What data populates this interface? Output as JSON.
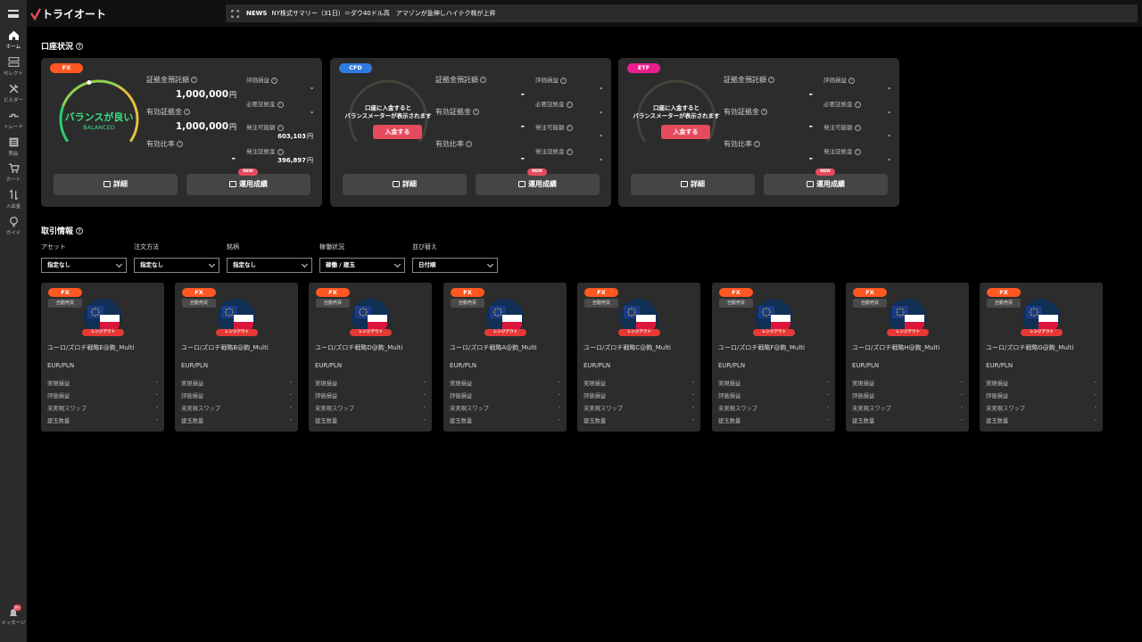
{
  "app": {
    "logo": "トライオート"
  },
  "news": {
    "label": "NEWS",
    "headline": "NY株式サマリー（31日）＝ダウ40ドル高　アマゾンが急伸しハイテク株が上昇"
  },
  "sidebar": {
    "items": [
      {
        "label": "ホーム",
        "icon": "home-icon"
      },
      {
        "label": "セレクト",
        "icon": "select-icon"
      },
      {
        "label": "ビルダー",
        "icon": "builder-icon"
      },
      {
        "label": "トレード",
        "icon": "trade-icon"
      },
      {
        "label": "照会",
        "icon": "inquiry-icon"
      },
      {
        "label": "カート",
        "icon": "cart-icon"
      },
      {
        "label": "入出金",
        "icon": "transfer-icon"
      },
      {
        "label": "ガイド",
        "icon": "guide-icon"
      }
    ],
    "message": {
      "label": "メッセージ",
      "count": "9+"
    }
  },
  "account_section": {
    "title": "口座状況"
  },
  "accounts": [
    {
      "badge": "FX",
      "badge_color": "#ff5722",
      "gauge": {
        "status": "バランスが良い",
        "status_en": "BALANCED",
        "color": "#3ddc84"
      },
      "left": [
        {
          "label": "証拠金預託額",
          "value": "1,000,000",
          "unit": "円"
        },
        {
          "label": "有効証拠金",
          "value": "1,000,000",
          "unit": "円"
        },
        {
          "label": "有効比率",
          "value": "-",
          "unit": ""
        }
      ],
      "right": [
        {
          "label": "評価損益",
          "value": "-"
        },
        {
          "label": "必要証拠金",
          "value": "-"
        },
        {
          "label": "発注可能額",
          "value": "603,103",
          "unit": "円"
        },
        {
          "label": "発注証拠金",
          "value": "396,897",
          "unit": "円"
        }
      ],
      "buttons": {
        "detail": "詳細",
        "performance": "運用成績",
        "new": "NEW"
      }
    },
    {
      "badge": "CFD",
      "badge_color": "#2e7be0",
      "gauge": {
        "message_line1": "口座に入金すると",
        "message_line2": "バランスメーターが表示されます",
        "deposit": "入金する"
      },
      "left": [
        {
          "label": "証拠金預託額",
          "value": "-",
          "unit": ""
        },
        {
          "label": "有効証拠金",
          "value": "-",
          "unit": ""
        },
        {
          "label": "有効比率",
          "value": "-",
          "unit": ""
        }
      ],
      "right": [
        {
          "label": "評価損益",
          "value": "-"
        },
        {
          "label": "必要証拠金",
          "value": "-"
        },
        {
          "label": "発注可能額",
          "value": "-"
        },
        {
          "label": "発注証拠金",
          "value": "-"
        }
      ],
      "buttons": {
        "detail": "詳細",
        "performance": "運用成績",
        "new": "NEW"
      }
    },
    {
      "badge": "ETF",
      "badge_color": "#e91e8c",
      "gauge": {
        "message_line1": "口座に入金すると",
        "message_line2": "バランスメーターが表示されます",
        "deposit": "入金する"
      },
      "left": [
        {
          "label": "証拠金預託額",
          "value": "-",
          "unit": ""
        },
        {
          "label": "有効証拠金",
          "value": "-",
          "unit": ""
        },
        {
          "label": "有効比率",
          "value": "-",
          "unit": ""
        }
      ],
      "right": [
        {
          "label": "評価損益",
          "value": "-"
        },
        {
          "label": "必要証拠金",
          "value": "-"
        },
        {
          "label": "発注可能額",
          "value": "-"
        },
        {
          "label": "発注証拠金",
          "value": "-"
        }
      ],
      "buttons": {
        "detail": "詳細",
        "performance": "運用成績",
        "new": "NEW"
      }
    }
  ],
  "trade_section": {
    "title": "取引情報"
  },
  "filters": [
    {
      "label": "アセット",
      "value": "指定なし"
    },
    {
      "label": "注文方法",
      "value": "指定なし"
    },
    {
      "label": "銘柄",
      "value": "指定なし"
    },
    {
      "label": "稼働状況",
      "value": "稼働 / 建玉"
    },
    {
      "label": "並び替え",
      "value": "日付順"
    }
  ],
  "strategy_card_labels": {
    "asset": "FX",
    "mode": "自動売買",
    "range": "レンジアウト",
    "rows": [
      "実現損益",
      "評価損益",
      "未実現スワップ",
      "建玉数量"
    ]
  },
  "strategies": [
    {
      "name": "ユーロ/ズロチ戦略E@鉤_Multi",
      "pair": "EUR/PLN",
      "values": [
        "-",
        "-",
        "-",
        "-"
      ]
    },
    {
      "name": "ユーロ/ズロチ戦略B@鉤_Multi",
      "pair": "EUR/PLN",
      "values": [
        "-",
        "-",
        "-",
        "-"
      ]
    },
    {
      "name": "ユーロ/ズロチ戦略D@鉤_Multi",
      "pair": "EUR/PLN",
      "values": [
        "-",
        "-",
        "-",
        "-"
      ]
    },
    {
      "name": "ユーロ/ズロチ戦略A@鉤_Multi",
      "pair": "EUR/PLN",
      "values": [
        "-",
        "-",
        "-",
        "-"
      ]
    },
    {
      "name": "ユーロ/ズロチ戦略C@鉤_Multi",
      "pair": "EUR/PLN",
      "values": [
        "-",
        "-",
        "-",
        "-"
      ]
    },
    {
      "name": "ユーロ/ズロチ戦略F@鉤_Multi",
      "pair": "EUR/PLN",
      "values": [
        "-",
        "-",
        "-",
        "-"
      ]
    },
    {
      "name": "ユーロ/ズロチ戦略H@鉤_Multi",
      "pair": "EUR/PLN",
      "values": [
        "-",
        "-",
        "-",
        "-"
      ]
    },
    {
      "name": "ユーロ/ズロチ戦略G@鉤_Multi",
      "pair": "EUR/PLN",
      "values": [
        "-",
        "-",
        "-",
        "-"
      ]
    }
  ]
}
